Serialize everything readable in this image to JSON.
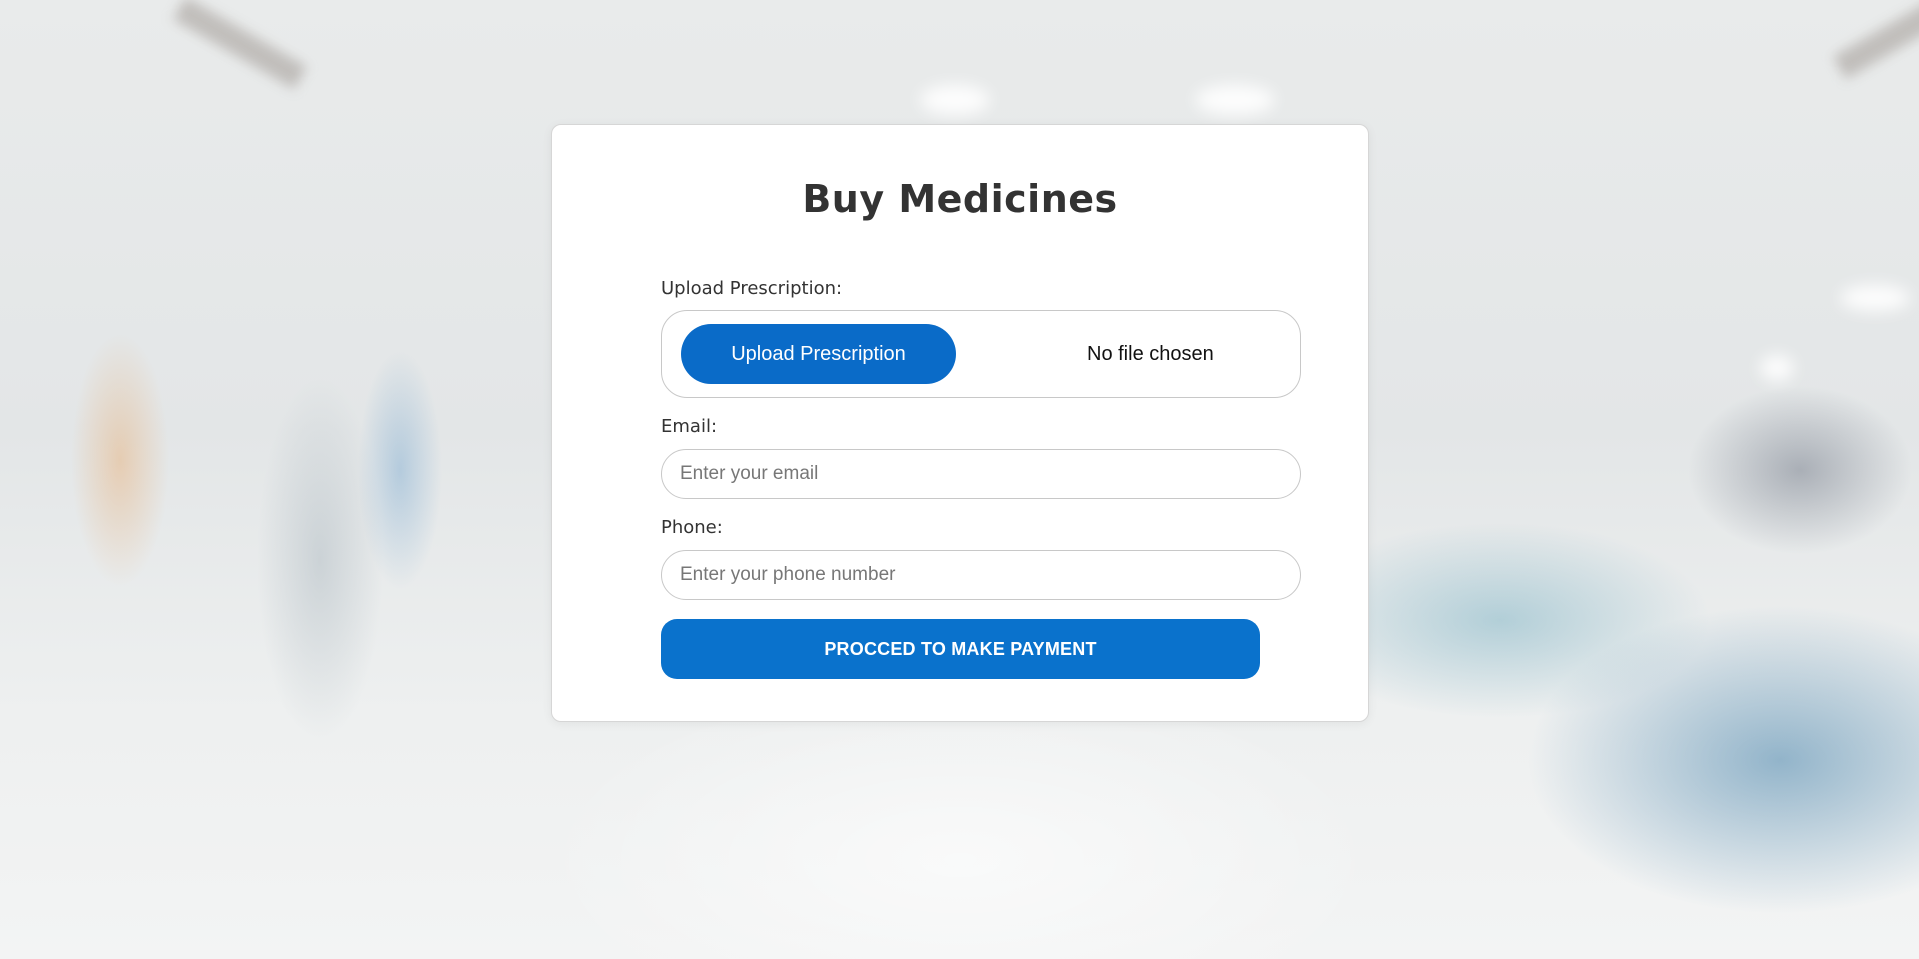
{
  "form": {
    "title": "Buy Medicines",
    "upload": {
      "label": "Upload Prescription:",
      "button_label": "Upload Prescription",
      "status": "No file chosen"
    },
    "email": {
      "label": "Email:",
      "placeholder": "Enter your email",
      "value": ""
    },
    "phone": {
      "label": "Phone:",
      "placeholder": "Enter your phone number",
      "value": ""
    },
    "submit_label": "PROCCED TO MAKE PAYMENT"
  },
  "colors": {
    "primary_button": "#0a6bc8",
    "card_background": "#ffffff",
    "title_text": "#333333"
  }
}
